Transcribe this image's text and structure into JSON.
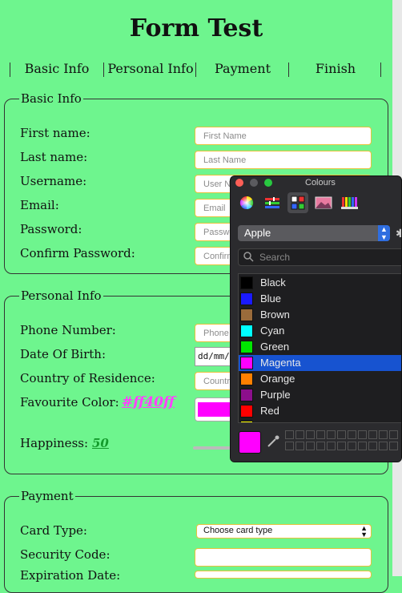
{
  "title": "Form Test",
  "nav": {
    "tabs": [
      "Basic Info",
      "Personal Info",
      "Payment",
      "Finish"
    ]
  },
  "basic_info": {
    "legend": "Basic Info",
    "fields": [
      {
        "label": "First name:",
        "placeholder": "First Name"
      },
      {
        "label": "Last name:",
        "placeholder": "Last Name"
      },
      {
        "label": "Username:",
        "placeholder": "User Name"
      },
      {
        "label": "Email:",
        "placeholder": "Email"
      },
      {
        "label": "Password:",
        "placeholder": "Password"
      },
      {
        "label": "Confirm Password:",
        "placeholder": "Confirm Password"
      }
    ]
  },
  "personal_info": {
    "legend": "Personal Info",
    "phone_label": "Phone Number:",
    "phone_placeholder": "Phone Number",
    "dob_label": "Date Of Birth:",
    "dob_value": "dd/mm/yyyy",
    "country_label": "Country of Residence:",
    "country_placeholder": "Country",
    "color_label": "Favourite Color:",
    "color_value": "#ff40ff",
    "color_swatch": "#ff00ff",
    "happiness_label": "Happiness:",
    "happiness_value": "50"
  },
  "payment": {
    "legend": "Payment",
    "card_type_label": "Card Type:",
    "card_type_value": "Choose card type",
    "security_label": "Security Code:",
    "expiration_label": "Expiration Date:"
  },
  "colour_panel": {
    "title": "Colours",
    "palette": "Apple",
    "search_placeholder": "Search",
    "selected_color": "#ff00ff",
    "colors": [
      {
        "name": "Black",
        "hex": "#000000"
      },
      {
        "name": "Blue",
        "hex": "#1a1aff"
      },
      {
        "name": "Brown",
        "hex": "#9a6b3b"
      },
      {
        "name": "Cyan",
        "hex": "#00ffff"
      },
      {
        "name": "Green",
        "hex": "#00e600"
      },
      {
        "name": "Magenta",
        "hex": "#ff00ff"
      },
      {
        "name": "Orange",
        "hex": "#ff8000"
      },
      {
        "name": "Purple",
        "hex": "#8c0f8c"
      },
      {
        "name": "Red",
        "hex": "#ff0000"
      },
      {
        "name": "Yellow",
        "hex": "#ffff00"
      }
    ],
    "selected_index": 5
  },
  "colors": {
    "background": "#6ef58e",
    "input_border": "#e7c23c",
    "selected_row": "#1753d0"
  }
}
